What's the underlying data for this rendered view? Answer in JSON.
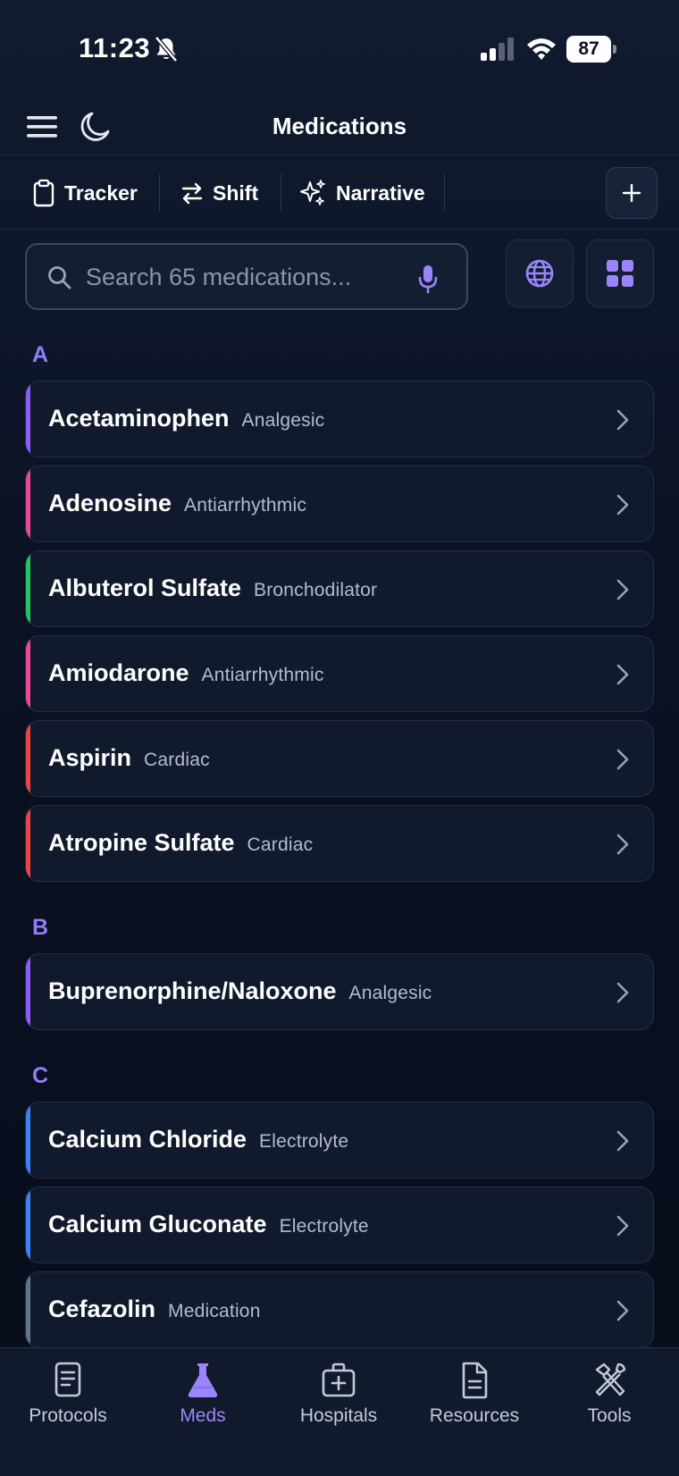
{
  "status_bar": {
    "time": "11:23",
    "battery": "87"
  },
  "header": {
    "title": "Medications"
  },
  "toolbar": {
    "tracker_label": "Tracker",
    "shift_label": "Shift",
    "narrative_label": "Narrative"
  },
  "search": {
    "placeholder": "Search 65 medications..."
  },
  "sections": [
    {
      "letter": "A",
      "items": [
        {
          "name": "Acetaminophen",
          "class": "Analgesic",
          "color": "#8b5cf6"
        },
        {
          "name": "Adenosine",
          "class": "Antiarrhythmic",
          "color": "#ec4899"
        },
        {
          "name": "Albuterol Sulfate",
          "class": "Bronchodilator",
          "color": "#22c55e"
        },
        {
          "name": "Amiodarone",
          "class": "Antiarrhythmic",
          "color": "#ec4899"
        },
        {
          "name": "Aspirin",
          "class": "Cardiac",
          "color": "#ef4444"
        },
        {
          "name": "Atropine Sulfate",
          "class": "Cardiac",
          "color": "#ef4444"
        }
      ]
    },
    {
      "letter": "B",
      "items": [
        {
          "name": "Buprenorphine/Naloxone",
          "class": "Analgesic",
          "color": "#8b5cf6"
        }
      ]
    },
    {
      "letter": "C",
      "items": [
        {
          "name": "Calcium Chloride",
          "class": "Electrolyte",
          "color": "#3b82f6"
        },
        {
          "name": "Calcium Gluconate",
          "class": "Electrolyte",
          "color": "#3b82f6"
        },
        {
          "name": "Cefazolin",
          "class": "Medication",
          "color": "#64748b"
        }
      ]
    }
  ],
  "bottom_nav": [
    {
      "label": "Protocols",
      "icon": "document-icon",
      "active": false
    },
    {
      "label": "Meds",
      "icon": "flask-icon",
      "active": true
    },
    {
      "label": "Hospitals",
      "icon": "medical-kit-icon",
      "active": false
    },
    {
      "label": "Resources",
      "icon": "file-icon",
      "active": false
    },
    {
      "label": "Tools",
      "icon": "tools-icon",
      "active": false
    }
  ],
  "colors": {
    "accent": "#9a86f9",
    "background": "#0a1020"
  }
}
